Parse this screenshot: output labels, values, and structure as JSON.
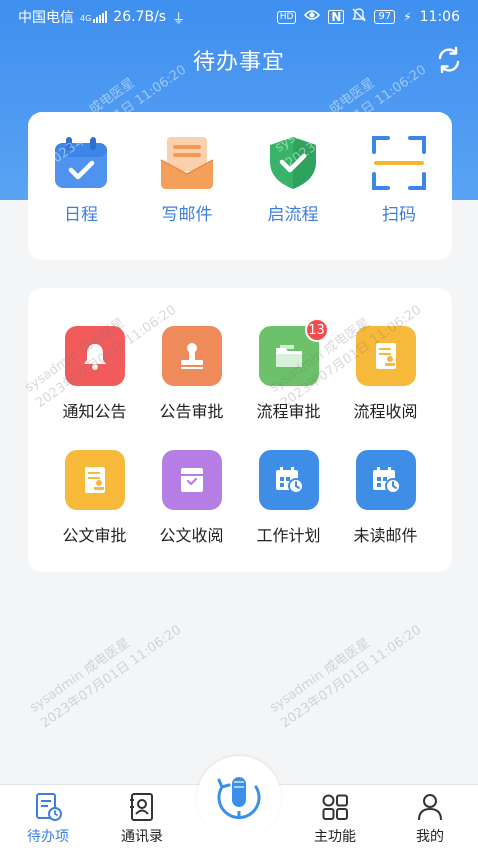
{
  "status_bar": {
    "carrier": "中国电信",
    "network": "4G",
    "speed": "26.7B/s",
    "hd": "HD",
    "battery": "97",
    "time": "11:06"
  },
  "header": {
    "title": "待办事宜",
    "refresh_icon": "refresh-icon"
  },
  "quick_actions": [
    {
      "label": "日程",
      "icon": "calendar-icon",
      "color": "#3d86e8"
    },
    {
      "label": "写邮件",
      "icon": "mail-icon",
      "color": "#f5a05a"
    },
    {
      "label": "启流程",
      "icon": "shield-check-icon",
      "color": "#3ab36a"
    },
    {
      "label": "扫码",
      "icon": "scan-icon",
      "color": "#f7b52b"
    }
  ],
  "functions": [
    {
      "label": "通知公告",
      "icon": "bell-icon",
      "color": "#f25b5b",
      "badge": ""
    },
    {
      "label": "公告审批",
      "icon": "stamp-icon",
      "color": "#ef8a5a",
      "badge": ""
    },
    {
      "label": "流程审批",
      "icon": "folder-icon",
      "color": "#6cc16a",
      "badge": "13"
    },
    {
      "label": "流程收阅",
      "icon": "document-stamp-icon",
      "color": "#f7b93a",
      "badge": ""
    },
    {
      "label": "公文审批",
      "icon": "document-stamp-icon",
      "color": "#f7b93a",
      "badge": ""
    },
    {
      "label": "公文收阅",
      "icon": "inbox-icon",
      "color": "#b47ee5",
      "badge": ""
    },
    {
      "label": "工作计划",
      "icon": "calendar-clock-icon",
      "color": "#3f8ee6",
      "badge": ""
    },
    {
      "label": "未读邮件",
      "icon": "calendar-clock-icon",
      "color": "#3f8ee6",
      "badge": ""
    }
  ],
  "watermark": {
    "line1": "sysadmin 成电医星",
    "line2": "2023年07月01日 11:06:20"
  },
  "tabbar": {
    "items": [
      {
        "label": "待办项",
        "icon": "todo-icon",
        "active": true
      },
      {
        "label": "通讯录",
        "icon": "contacts-icon",
        "active": false
      },
      {
        "label": "主功能",
        "icon": "grid-icon",
        "active": false
      },
      {
        "label": "我的",
        "icon": "user-icon",
        "active": false
      }
    ],
    "center_icon": "microphone-icon",
    "accent": "#3c7fe0"
  }
}
